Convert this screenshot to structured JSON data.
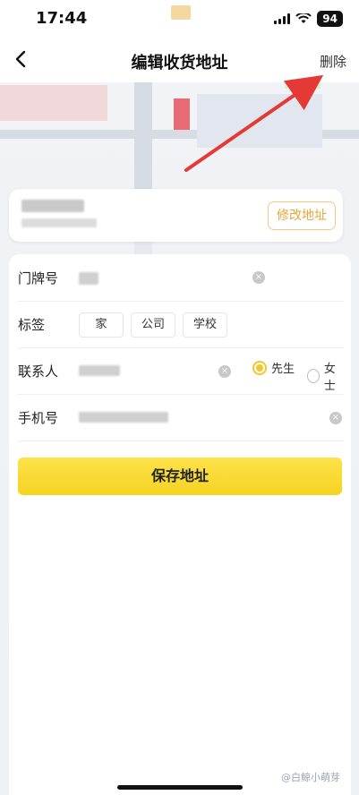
{
  "status_bar": {
    "time": "17:44",
    "battery": "94"
  },
  "header": {
    "title": "编辑收货地址",
    "delete_label": "删除"
  },
  "address_card": {
    "edit_label": "修改地址"
  },
  "form": {
    "door_label": "门牌号",
    "tag_label": "标签",
    "tags": [
      "家",
      "公司",
      "学校"
    ],
    "contact_label": "联系人",
    "gender_options": [
      "先生",
      "女士"
    ],
    "gender_selected": "先生",
    "phone_label": "手机号",
    "save_label": "保存地址"
  },
  "watermark": "@白鲸小萌芽",
  "colors": {
    "accent_yellow": "#f6d322",
    "edit_border": "#f3c98a",
    "arrow": "#e53935"
  }
}
